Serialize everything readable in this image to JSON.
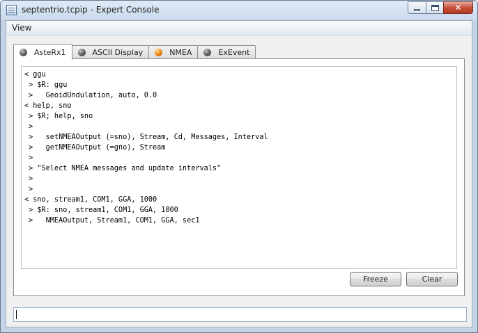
{
  "window": {
    "title": "septentrio.tcpip - Expert Console",
    "close_glyph": "✕"
  },
  "menu": {
    "items": [
      "View"
    ]
  },
  "tabs": [
    {
      "label": "AsteRx1",
      "status": "grey",
      "active": true
    },
    {
      "label": "ASCII Display",
      "status": "grey",
      "active": false
    },
    {
      "label": "NMEA",
      "status": "orange",
      "active": false
    },
    {
      "label": "ExEvent",
      "status": "grey",
      "active": false
    }
  ],
  "console": {
    "lines": [
      "< ggu",
      " > $R: ggu",
      " >   GeoidUndulation, auto, 0.0",
      "< help, sno",
      " > $R; help, sno",
      " >",
      " >   setNMEAOutput (=sno), Stream, Cd, Messages, Interval",
      " >   getNMEAOutput (=gno), Stream",
      " >",
      " > \"Select NMEA messages and update intervals\"",
      " >",
      " >",
      "< sno, stream1, COM1, GGA, 1000",
      " > $R: sno, stream1, COM1, GGA, 1000",
      " >   NMEAOutput, Stream1, COM1, GGA, sec1"
    ]
  },
  "buttons": {
    "freeze": "Freeze",
    "clear": "Clear"
  },
  "command": {
    "value": ""
  },
  "colors": {
    "status_grey": "#5a5a5a",
    "status_orange": "#f0901a",
    "close_button": "#c7503b"
  }
}
